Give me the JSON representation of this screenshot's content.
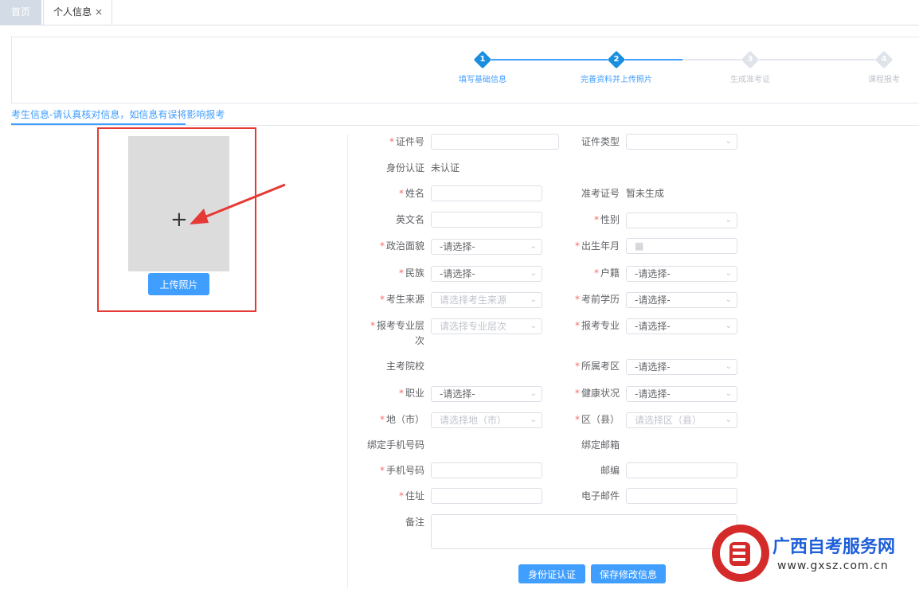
{
  "tabs": {
    "home": "首页",
    "active": "个人信息",
    "close": "×"
  },
  "steps": [
    {
      "num": "1",
      "label": "填写基础信息",
      "state": "done"
    },
    {
      "num": "2",
      "label": "完善资料并上传照片",
      "state": "active"
    },
    {
      "num": "3",
      "label": "生成准考证",
      "state": "pending"
    },
    {
      "num": "4",
      "label": "课程报考",
      "state": "pending"
    }
  ],
  "section_title": "考生信息-请认真核对信息，如信息有误将影响报考",
  "photo": {
    "upload_label": "上传照片",
    "plus": "+"
  },
  "required_mark": "*",
  "form": {
    "id_no": {
      "label": "证件号",
      "value": ""
    },
    "id_type": {
      "label": "证件类型",
      "value": ""
    },
    "id_auth": {
      "label": "身份认证",
      "value": "未认证"
    },
    "name": {
      "label": "姓名",
      "value": ""
    },
    "ticket_no": {
      "label": "准考证号",
      "value": "暂未生成"
    },
    "en_name": {
      "label": "英文名",
      "value": ""
    },
    "gender": {
      "label": "性别",
      "value": ""
    },
    "political": {
      "label": "政治面貌",
      "value": "-请选择-"
    },
    "birth": {
      "label": "出生年月",
      "value": ""
    },
    "nation": {
      "label": "民族",
      "value": "-请选择-"
    },
    "hukou": {
      "label": "户籍",
      "value": "-请选择-"
    },
    "source": {
      "label": "考生来源",
      "placeholder": "请选择考生来源"
    },
    "prev_edu": {
      "label": "考前学历",
      "value": "-请选择-"
    },
    "level": {
      "label": "报考专业层",
      "label2": "次",
      "placeholder": "请选择专业层次"
    },
    "major": {
      "label": "报考专业",
      "value": "-请选择-"
    },
    "school": {
      "label": "主考院校",
      "value": ""
    },
    "area": {
      "label": "所属考区",
      "value": "-请选择-"
    },
    "job": {
      "label": "职业",
      "value": "-请选择-"
    },
    "health": {
      "label": "健康状况",
      "value": "-请选择-"
    },
    "city": {
      "label": "地（市）",
      "placeholder": "请选择地（市）"
    },
    "district": {
      "label": "区（县）",
      "placeholder": "请选择区（县）"
    },
    "bind_phone": {
      "label": "绑定手机号码",
      "value": ""
    },
    "bind_email": {
      "label": "绑定邮箱",
      "value": ""
    },
    "phone": {
      "label": "手机号码",
      "value": ""
    },
    "postcode": {
      "label": "邮编",
      "value": ""
    },
    "address": {
      "label": "住址",
      "value": ""
    },
    "email": {
      "label": "电子邮件",
      "value": ""
    },
    "remark": {
      "label": "备注",
      "value": ""
    }
  },
  "buttons": {
    "auth": "身份证认证",
    "save": "保存修改信息"
  },
  "watermark": {
    "title": "广西自考服务网",
    "url": "www.gxsz.com.cn"
  },
  "colors": {
    "primary": "#409eff",
    "required": "#f56c6c",
    "annotation": "#e53935"
  }
}
